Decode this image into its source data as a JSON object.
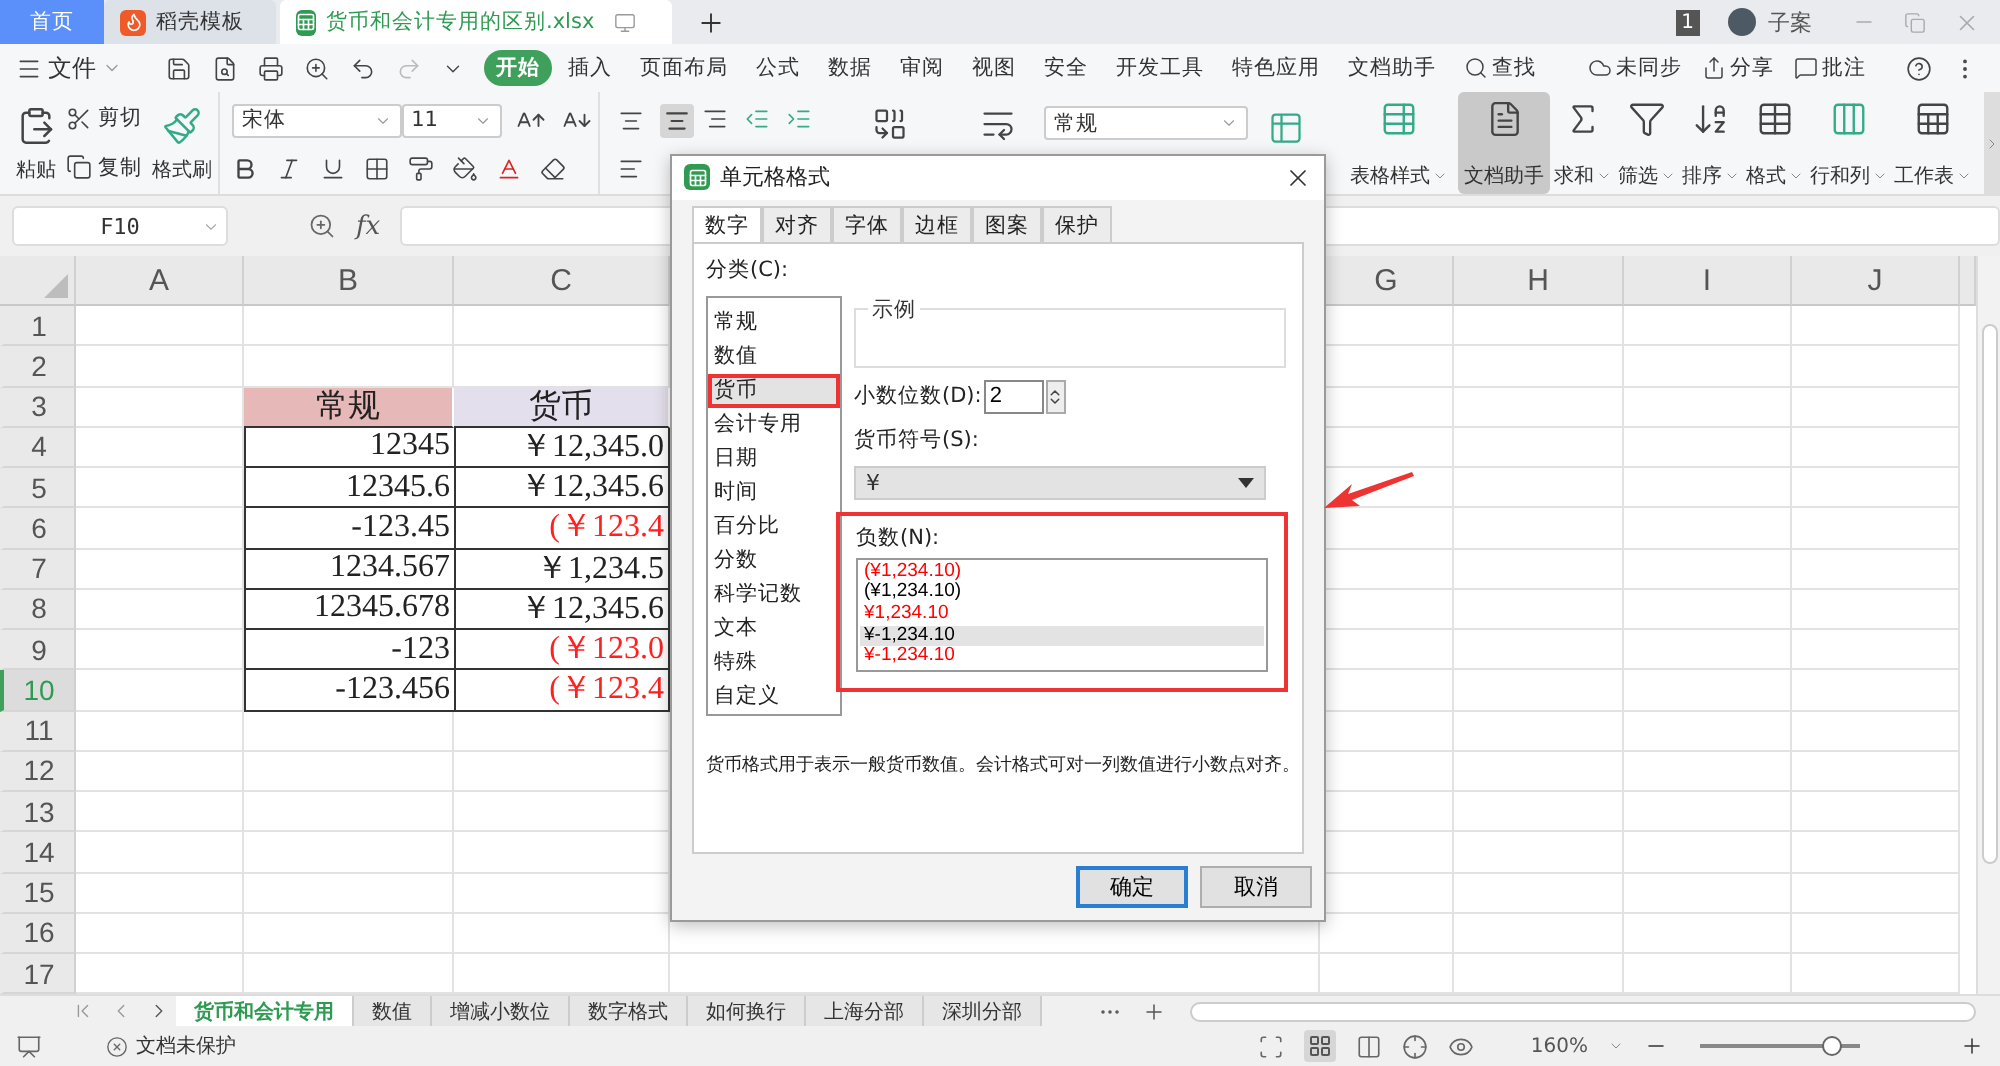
{
  "title_bar": {
    "tabs": [
      {
        "label": "首页",
        "kind": "home",
        "selected": false
      },
      {
        "label": "稻壳模板",
        "kind": "docer",
        "selected": false
      },
      {
        "label": "货币和会计专用的区别.xlsx",
        "kind": "sheet",
        "selected": true
      }
    ],
    "badge": "1",
    "user": "子案"
  },
  "menu": {
    "file": "文件",
    "items": [
      {
        "label": "开始",
        "kind": "tab",
        "selected": true
      },
      {
        "label": "插入",
        "kind": "tab",
        "selected": false
      },
      {
        "label": "页面布局",
        "kind": "tab",
        "selected": false
      },
      {
        "label": "公式",
        "kind": "tab",
        "selected": false
      },
      {
        "label": "数据",
        "kind": "tab",
        "selected": false
      },
      {
        "label": "审阅",
        "kind": "tab",
        "selected": false
      },
      {
        "label": "视图",
        "kind": "tab",
        "selected": false
      },
      {
        "label": "安全",
        "kind": "tab",
        "selected": false
      },
      {
        "label": "开发工具",
        "kind": "tab",
        "selected": false
      },
      {
        "label": "特色应用",
        "kind": "tab",
        "selected": false
      },
      {
        "label": "文档助手",
        "kind": "tab",
        "selected": false
      },
      {
        "label": "查找",
        "kind": "search",
        "selected": false
      }
    ],
    "actions": [
      {
        "label": "未同步",
        "kind": "sync"
      },
      {
        "label": "分享",
        "kind": "share"
      },
      {
        "label": "批注",
        "kind": "comment"
      }
    ]
  },
  "ribbon": {
    "clipboard": [
      {
        "label": "粘贴",
        "kind": "paste"
      },
      {
        "label": "剪切",
        "kind": "cut"
      },
      {
        "label": "复制",
        "kind": "copy"
      },
      {
        "label": "格式刷",
        "kind": "painter"
      }
    ],
    "font": "宋体",
    "font_size": "11",
    "number_format": "常规",
    "tools": [
      {
        "label": "表格样式",
        "kind": "table-style",
        "selected": false,
        "dropdown": true
      },
      {
        "label": "文档助手",
        "kind": "assistant",
        "selected": true,
        "dropdown": false
      },
      {
        "label": "求和",
        "kind": "sum",
        "selected": false,
        "dropdown": true
      },
      {
        "label": "筛选",
        "kind": "filter",
        "selected": false,
        "dropdown": true
      },
      {
        "label": "排序",
        "kind": "sort",
        "selected": false,
        "dropdown": true
      },
      {
        "label": "格式",
        "kind": "format",
        "selected": false,
        "dropdown": true
      },
      {
        "label": "行和列",
        "kind": "rows-cols",
        "selected": false,
        "dropdown": true
      },
      {
        "label": "工作表",
        "kind": "worksheet",
        "selected": false,
        "dropdown": true
      }
    ]
  },
  "formula_bar": {
    "name_box": "F10",
    "fx": "fx"
  },
  "sheet": {
    "columns": [
      "A",
      "B",
      "C",
      "G",
      "H",
      "I",
      "J"
    ],
    "rows": [
      {
        "number": "1",
        "selected": false
      },
      {
        "number": "2",
        "selected": false
      },
      {
        "number": "3",
        "selected": false,
        "cells": [
          {
            "text": "常规",
            "kind": "header",
            "color": "#e6b8b7"
          },
          {
            "text": "货币",
            "kind": "header",
            "color": "#e4dfec"
          }
        ]
      },
      {
        "number": "4",
        "selected": false,
        "cells": [
          {
            "text": "12345",
            "kind": "value",
            "negative": false
          },
          {
            "text": "￥12,345.0",
            "kind": "value",
            "negative": false
          }
        ]
      },
      {
        "number": "5",
        "selected": false,
        "cells": [
          {
            "text": "12345.6",
            "kind": "value",
            "negative": false
          },
          {
            "text": "￥12,345.6",
            "kind": "value",
            "negative": false
          }
        ]
      },
      {
        "number": "6",
        "selected": false,
        "cells": [
          {
            "text": "-123.45",
            "kind": "value",
            "negative": false
          },
          {
            "text": "(￥123.4",
            "kind": "value",
            "negative": true
          }
        ]
      },
      {
        "number": "7",
        "selected": false,
        "cells": [
          {
            "text": "1234.567",
            "kind": "value",
            "negative": false
          },
          {
            "text": "￥1,234.5",
            "kind": "value",
            "negative": false
          }
        ]
      },
      {
        "number": "8",
        "selected": false,
        "cells": [
          {
            "text": "12345.678",
            "kind": "value",
            "negative": false
          },
          {
            "text": "￥12,345.6",
            "kind": "value",
            "negative": false
          }
        ]
      },
      {
        "number": "9",
        "selected": false,
        "cells": [
          {
            "text": "-123",
            "kind": "value",
            "negative": false
          },
          {
            "text": "(￥123.0",
            "kind": "value",
            "negative": true
          }
        ]
      },
      {
        "number": "10",
        "selected": true,
        "cells": [
          {
            "text": "-123.456",
            "kind": "value",
            "negative": false
          },
          {
            "text": "(￥123.4",
            "kind": "value",
            "negative": true
          }
        ]
      },
      {
        "number": "11",
        "selected": false
      },
      {
        "number": "12",
        "selected": false
      },
      {
        "number": "13",
        "selected": false
      },
      {
        "number": "14",
        "selected": false
      },
      {
        "number": "15",
        "selected": false
      },
      {
        "number": "16",
        "selected": false
      },
      {
        "number": "17",
        "selected": false
      }
    ]
  },
  "dialog": {
    "title": "单元格格式",
    "tabs": [
      {
        "label": "数字",
        "selected": true
      },
      {
        "label": "对齐",
        "selected": false
      },
      {
        "label": "字体",
        "selected": false
      },
      {
        "label": "边框",
        "selected": false
      },
      {
        "label": "图案",
        "selected": false
      },
      {
        "label": "保护",
        "selected": false
      }
    ],
    "category_label": "分类(C):",
    "categories": [
      {
        "label": "常规",
        "selected": false
      },
      {
        "label": "数值",
        "selected": false
      },
      {
        "label": "货币",
        "selected": true,
        "highlighted": true
      },
      {
        "label": "会计专用",
        "selected": false
      },
      {
        "label": "日期",
        "selected": false
      },
      {
        "label": "时间",
        "selected": false
      },
      {
        "label": "百分比",
        "selected": false
      },
      {
        "label": "分数",
        "selected": false
      },
      {
        "label": "科学记数",
        "selected": false
      },
      {
        "label": "文本",
        "selected": false
      },
      {
        "label": "特殊",
        "selected": false
      },
      {
        "label": "自定义",
        "selected": false
      }
    ],
    "sample_label": "示例",
    "decimal_label": "小数位数(D):",
    "decimal_value": "2",
    "symbol_label": "货币符号(S):",
    "symbol_value": "¥",
    "negative_label": "负数(N):",
    "negative_formats": [
      {
        "text": "(¥1,234.10)",
        "color": "#ff0000",
        "selected": false
      },
      {
        "text": "(¥1,234.10)",
        "color": "#000000",
        "selected": false
      },
      {
        "text": "¥1,234.10",
        "color": "#ff0000",
        "selected": false
      },
      {
        "text": "¥-1,234.10",
        "color": "#000000",
        "selected": true
      },
      {
        "text": "¥-1,234.10",
        "color": "#ff0000",
        "selected": false
      }
    ],
    "description": "货币格式用于表示一般货币数值。会计格式可对一列数值进行小数点对齐。",
    "buttons": [
      {
        "label": "确定",
        "default": true
      },
      {
        "label": "取消",
        "default": false
      }
    ]
  },
  "sheet_tabs": [
    {
      "label": "货币和会计专用",
      "selected": true
    },
    {
      "label": "数值",
      "selected": false
    },
    {
      "label": "增减小数位",
      "selected": false
    },
    {
      "label": "数字格式",
      "selected": false
    },
    {
      "label": "如何换行",
      "selected": false
    },
    {
      "label": "上海分部",
      "selected": false
    },
    {
      "label": "深圳分部",
      "selected": false
    }
  ],
  "status_bar": {
    "protection": "文档未保护",
    "zoom": "160%",
    "zoom_slider": {
      "level": 0.83
    }
  }
}
